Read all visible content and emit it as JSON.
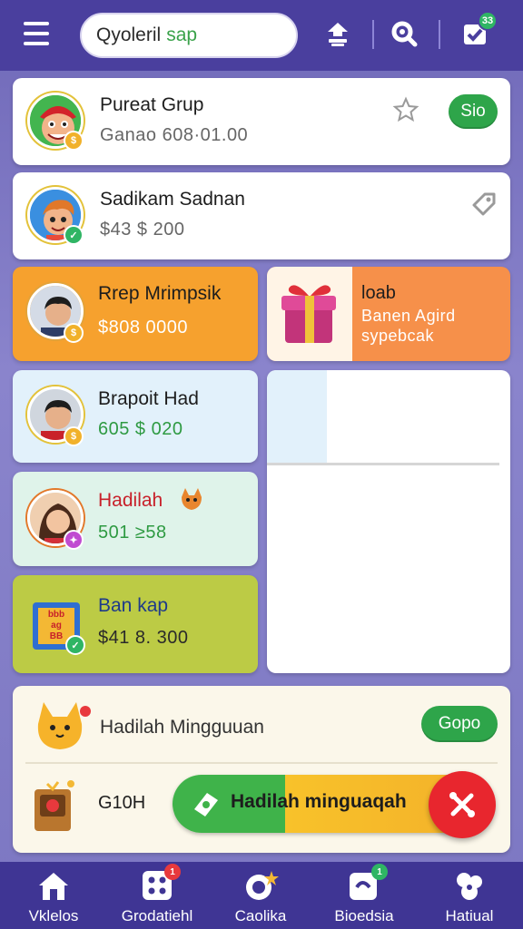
{
  "search": {
    "part1": "Qyoleril",
    "part2": "sap"
  },
  "cards": {
    "c1": {
      "title": "Pureat Grup",
      "sub": "Ganao  608·01.00",
      "button": "Sio"
    },
    "c2": {
      "title": "Sadikam Sadnan",
      "sub": "$43 $ 200"
    },
    "c3": {
      "title": "Rrep Mrimpsik",
      "sub": "$808 0000"
    },
    "c4": {
      "title": "loab",
      "sub1": "Banen Agird",
      "sub2": "sypebcak"
    },
    "c5": {
      "title": "Brapoit Had",
      "sub": "605 $ 020"
    },
    "c6": {
      "title": "Hadilah",
      "sub": "501 ≥58"
    },
    "c7": {
      "title": "Ban kap",
      "sub": "$41 8. 300"
    },
    "weekly": {
      "title": "Hadilah Mingguuan",
      "button": "Gopo"
    },
    "bottom": {
      "label": "G10H",
      "banner": "Hadilah minguaqah"
    },
    "c7_sticker": {
      "l1": "bbb",
      "l2": "ag",
      "l3": "BB"
    }
  },
  "nav": [
    {
      "label": "Vklelos",
      "icon": "home-icon"
    },
    {
      "label": "Grodatiehl",
      "icon": "grid-icon",
      "badge": "1"
    },
    {
      "label": "Caolika",
      "icon": "star-chat-icon"
    },
    {
      "label": "Bioedsia",
      "icon": "notes-icon",
      "badge": "1"
    },
    {
      "label": "Hatiual",
      "icon": "puzzle-icon"
    }
  ],
  "top_badge": "33",
  "colors": {
    "header": "#4a3f9e",
    "accent_green": "#2ea54a",
    "orange": "#f6a12e",
    "red": "#e8262e"
  }
}
